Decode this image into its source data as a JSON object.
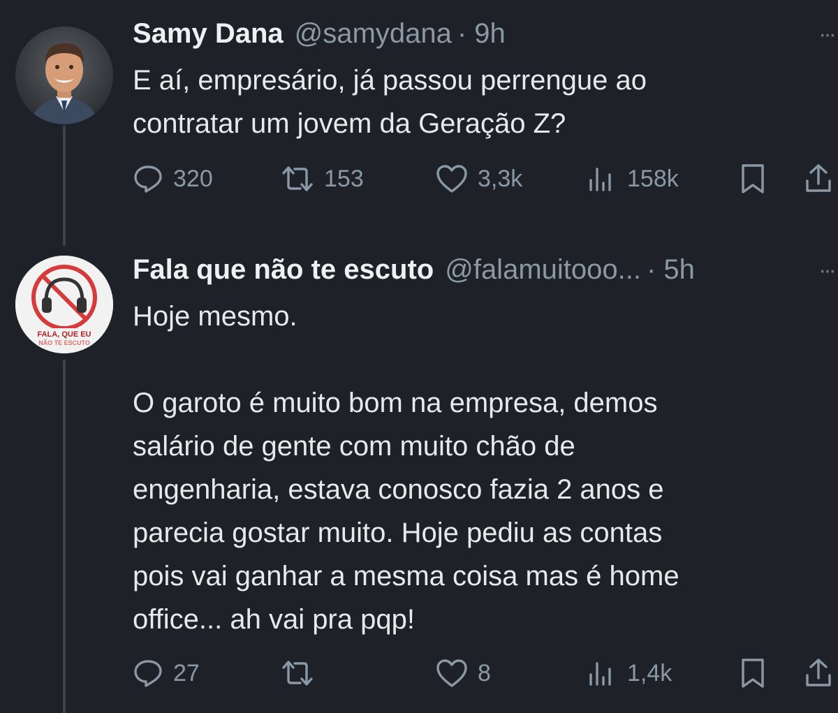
{
  "tweets": [
    {
      "name": "Samy Dana",
      "handle": "@samydana",
      "time": "· 9h",
      "more": "···",
      "text": "E aí, empresário, já passou perrengue ao\ncontratar um jovem da Geração Z?",
      "stats": {
        "replies": "320",
        "retweets": "153",
        "likes": "3,3k",
        "views": "158k"
      }
    },
    {
      "name": "Fala que não te escuto",
      "handle": "@falamuitooo...",
      "time": "· 5h",
      "more": "···",
      "avatar_text": {
        "line1": "FALA, QUE EU",
        "line2": "NÃO TE ESCUTO"
      },
      "text": "Hoje mesmo.\n\nO garoto é muito bom na empresa, demos\nsalário de gente com muito chão de\nengenharia, estava conosco fazia 2 anos e\nparecia gostar muito. Hoje pediu as contas\npois vai ganhar a mesma coisa mas é home\noffice... ah vai pra pqp!",
      "stats": {
        "replies": "27",
        "retweets": "",
        "likes": "8",
        "views": "1,4k"
      }
    }
  ],
  "colors": {
    "background": "#1e2228",
    "text": "#e7e9ea",
    "muted": "#8b98a5",
    "thread_line": "#3e4349"
  }
}
